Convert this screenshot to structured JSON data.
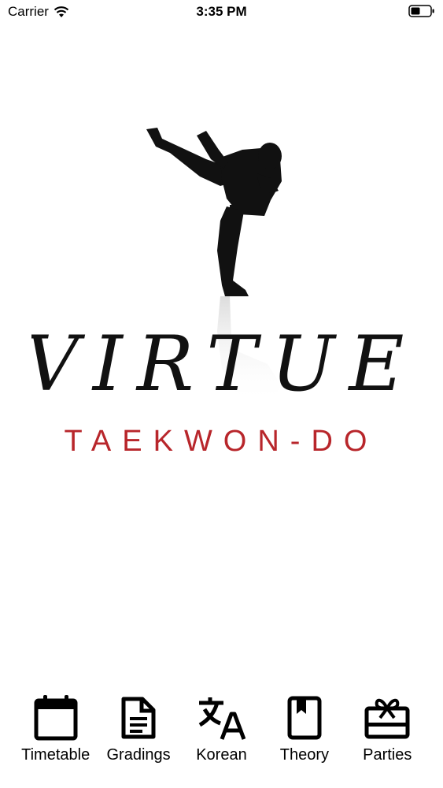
{
  "status_bar": {
    "carrier": "Carrier",
    "time": "3:35 PM"
  },
  "logo": {
    "word": "VIRTUE",
    "subtitle": "TAEKWON-DO",
    "subtitle_color": "#b8262b"
  },
  "tabs": [
    {
      "label": "Timetable",
      "icon": "calendar-icon"
    },
    {
      "label": "Gradings",
      "icon": "document-icon"
    },
    {
      "label": "Korean",
      "icon": "translate-icon"
    },
    {
      "label": "Theory",
      "icon": "book-icon"
    },
    {
      "label": "Parties",
      "icon": "gift-card-icon"
    }
  ]
}
